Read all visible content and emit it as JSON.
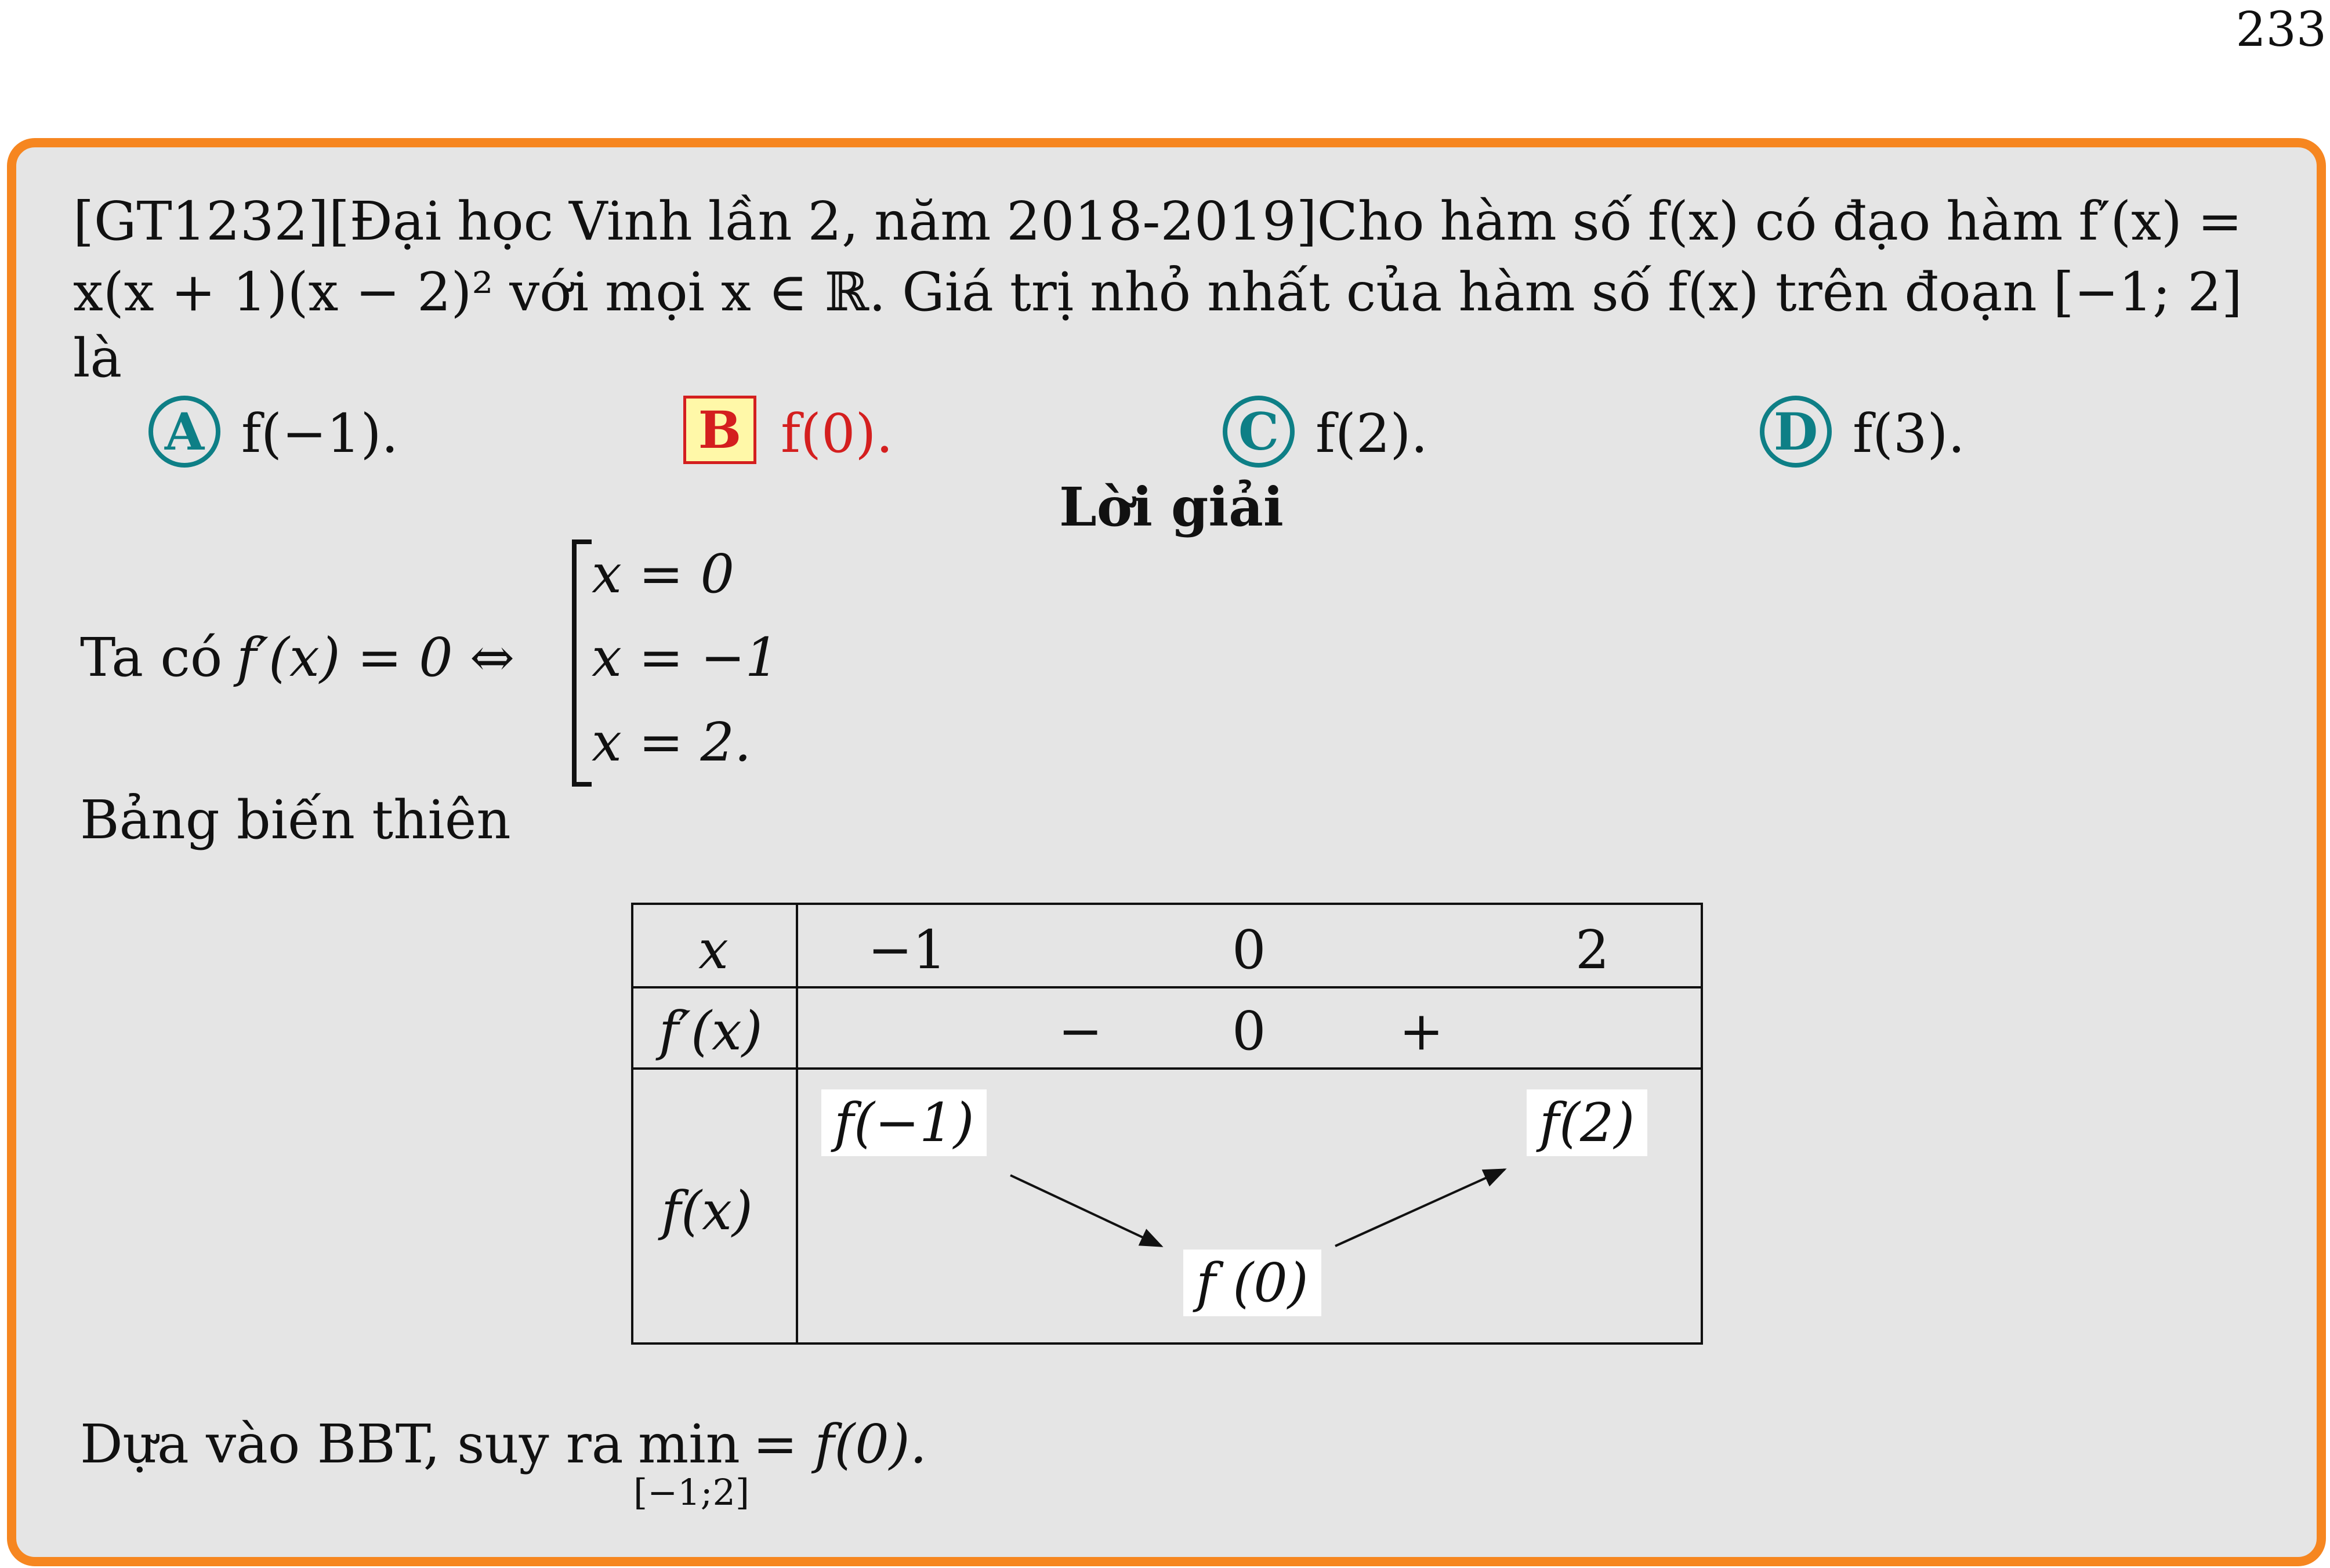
{
  "page_number": "233",
  "question": {
    "line1": [
      "[GT1232][Đại",
      "học",
      "Vinh",
      "lần",
      "2,",
      "năm",
      "2018-2019]Cho",
      "hàm",
      "số",
      "f(x)",
      "có",
      "đạo",
      "hàm",
      "f′(x)",
      "="
    ],
    "line2": [
      "x(x + 1)(x − 2)²",
      "với",
      "mọi",
      "x ∈ ℝ.",
      "Giá",
      "trị",
      "nhỏ",
      "nhất",
      "của",
      "hàm",
      "số",
      "f(x)",
      "trên",
      "đoạn",
      "[−1; 2]"
    ],
    "line3": "là"
  },
  "options": [
    {
      "letter": "A",
      "text": "f(−1).",
      "correct": false
    },
    {
      "letter": "B",
      "text": "f(0).",
      "correct": true
    },
    {
      "letter": "C",
      "text": "f(2).",
      "correct": false
    },
    {
      "letter": "D",
      "text": "f(3).",
      "correct": false
    }
  ],
  "solution": {
    "heading": "Lời giải",
    "intro": "Ta có",
    "equation": "f′(x) = 0 ⇔",
    "cases": [
      "x = 0",
      "x = −1",
      "x = 2."
    ],
    "table_caption": "Bảng biến thiên",
    "conclusion_prefix": "Dựa vào BBT, suy ra",
    "conclusion_min": "min",
    "conclusion_sub": "[−1;2]",
    "conclusion_suffix": "= f(0)."
  },
  "variation_table": {
    "row_labels": [
      "x",
      "f′(x)",
      "f(x)"
    ],
    "x_values": [
      "−1",
      "0",
      "2"
    ],
    "derivative": [
      "−",
      "0",
      "+"
    ],
    "f_values": [
      "f(−1)",
      "f (0)",
      "f(2)"
    ]
  },
  "colors": {
    "frame": "#f68620",
    "box_background": "#e5e5e5",
    "option_marker": "#0e7f86",
    "correct": "#d41f1f"
  }
}
